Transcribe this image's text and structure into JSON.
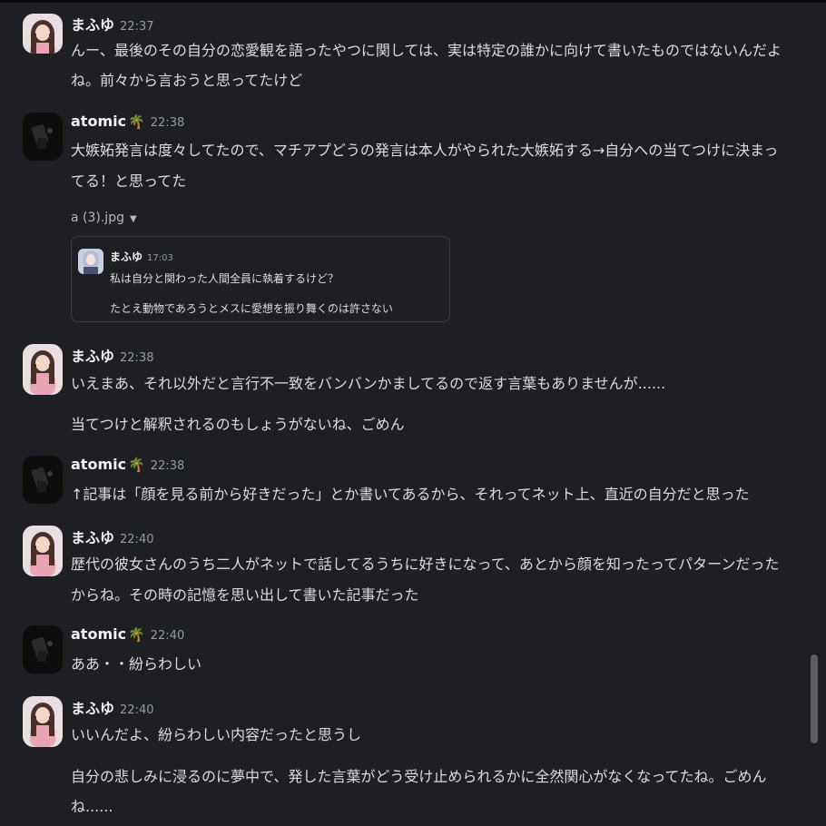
{
  "messages": [
    {
      "user": "まふゆ",
      "avatar": "mafuyu-avatar-icon",
      "time": "22:37",
      "lines": [
        "んー、最後のその自分の恋愛観を語ったやつに関しては、実は特定の誰かに向けて書いたものではないんだよ",
        "ね。前々から言おうと思ってたけど"
      ]
    },
    {
      "user": "atomic",
      "badge": "🌴",
      "avatar": "atomic-avatar-icon",
      "time": "22:38",
      "lines": [
        "大嫉妬発言は度々してたので、マチアプどうの発言は本人がやられた大嫉妬する→自分への当てつけに決まっ",
        "てる！と思ってた"
      ],
      "attachment": {
        "filename": "a (3).jpg",
        "embed": {
          "user": "まふゆ",
          "time": "17:03",
          "lines": [
            "私は自分と関わった人間全員に執着するけど？",
            "たとえ動物であろうとメスに愛想を振り舞くのは許さない"
          ]
        }
      }
    },
    {
      "user": "まふゆ",
      "avatar": "mafuyu-avatar-icon",
      "time": "22:38",
      "lines": [
        "いえまあ、それ以外だと言行不一致をバンバンかましてるので返す言葉もありませんが......",
        "当てつけと解釈されるのもしょうがないね、ごめん"
      ]
    },
    {
      "user": "atomic",
      "badge": "🌴",
      "avatar": "atomic-avatar-icon",
      "time": "22:38",
      "lines": [
        "↑記事は「顔を見る前から好きだった」とか書いてあるから、それってネット上、直近の自分だと思った"
      ]
    },
    {
      "user": "まふゆ",
      "avatar": "mafuyu-avatar-icon",
      "time": "22:40",
      "lines": [
        "歴代の彼女さんのうち二人がネットで話してるうちに好きになって、あとから顔を知ったってパターンだった",
        "からね。その時の記憶を思い出して書いた記事だった"
      ]
    },
    {
      "user": "atomic",
      "badge": "🌴",
      "avatar": "atomic-avatar-icon",
      "time": "22:40",
      "lines": [
        "ああ・・紛らわしい"
      ]
    },
    {
      "user": "まふゆ",
      "avatar": "mafuyu-avatar-icon",
      "time": "22:40",
      "lines": [
        "いいんだよ、紛らわしい内容だったと思うし",
        "自分の悲しみに浸るのに夢中で、発した言葉がどう受け止められるかに全然関心がなくなってたね。ごめん",
        "ね......"
      ]
    }
  ],
  "colors": {
    "background": "#1e1f22",
    "text": "#dbdee1",
    "username": "#f2f3f5",
    "timestamp": "#949ba4",
    "embed_border": "#3a3c41"
  }
}
